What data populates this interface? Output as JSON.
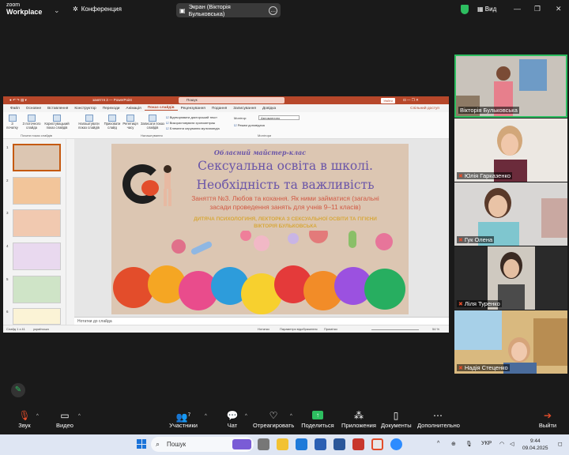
{
  "app": {
    "logo_line1": "zoom",
    "logo_line2": "Workplace"
  },
  "topbar": {
    "conference_label": "Конференция",
    "screen_label": "Экран (Вікторія Бульковська)",
    "view_label": "Вид"
  },
  "pp": {
    "file_name": "заняття 3 — PowerPoint",
    "search_placeholder": "Пошук",
    "signin_label": "Увійти",
    "tabs": [
      "Файл",
      "Основне",
      "Вставлення",
      "Конструктор",
      "Переходи",
      "Анімація",
      "Показ слайдів",
      "Рецензування",
      "Подання",
      "Записування",
      "Довідка"
    ],
    "share_label": "Спільний доступ",
    "ribbon": {
      "from_start": "З початку",
      "from_current": "З поточного слайда",
      "custom_show": "Користувацький показ слайдів",
      "setup_show": "Налаштувати показ слайдів",
      "hide_slide": "Приховати слайд",
      "rehearse": "Репетиція часу",
      "record": "Записати показ слайдів",
      "play_narrations": "Відтворювати дикторський текст",
      "use_timings": "Використовувати хронометраж",
      "show_media_controls": "Елементи керування мультимедіа",
      "monitor_label": "Монітор:",
      "monitor_value": "Автоматично",
      "presenter_view": "Режим доповідача",
      "group_start": "Почати показ слайдів",
      "group_setup": "Налаштування",
      "group_monitors": "Монітори"
    },
    "slide_numbers": [
      "1",
      "2",
      "3",
      "4",
      "5",
      "6"
    ],
    "notes_placeholder": "Нотатки до слайда",
    "status": {
      "slide_count": "Слайд 1 з 41",
      "language": "українська",
      "notes": "Нотатки",
      "display_settings": "Параметри відображення",
      "comments": "Примітки",
      "zoom": "54 %"
    }
  },
  "slide": {
    "subtitle": "Обласний майстер-клас",
    "title_line1": "Сексуальна освіта в школі.",
    "title_line2": "Необхідність та важливість",
    "lesson_line1": "Заняття №3. Любов та кохання. Як ними займатися (загальні",
    "lesson_line2": "засади проведення занять для учнів 9–11 класів)",
    "author_line1": "ДИТЯЧА ПСИХОЛОГИНЯ, ЛЕКТОРКА З СЕКСУАЛЬНОЇ ОСВІТИ ТА ГІГІЄНИ",
    "author_line2": "ВІКТОРІЯ БУЛЬКОВСЬКА"
  },
  "participants": [
    {
      "name": "Вікторія Бульковська",
      "muted": false
    },
    {
      "name": "Юлія Гарказенко",
      "muted": true
    },
    {
      "name": "Гук Олена",
      "muted": true
    },
    {
      "name": "Ліля Туренко",
      "muted": true
    },
    {
      "name": "Надія Стеценко",
      "muted": true
    }
  ],
  "toolbar": {
    "audio": "Звук",
    "video": "Видео",
    "participants": "Участники",
    "participants_count": "7",
    "chat": "Чат",
    "react": "Отреагировать",
    "share": "Поделиться",
    "apps": "Приложения",
    "docs": "Документы",
    "more": "Дополнительно",
    "leave": "Выйти"
  },
  "taskbar": {
    "search": "Пошук",
    "lang": "УКР",
    "time": "9:44",
    "date": "09.04.2025"
  },
  "colors": {
    "accent": "#2dbe60",
    "pp_red": "#b7472a",
    "slide_title": "#6a55a8",
    "slide_lesson": "#d15a44"
  }
}
